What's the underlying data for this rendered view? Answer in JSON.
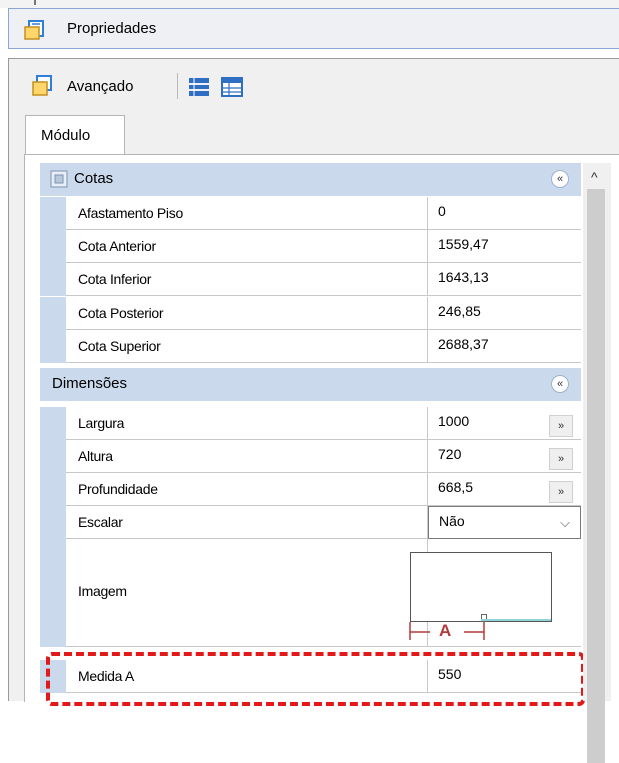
{
  "window": {
    "title": "Propriedades"
  },
  "toolbar": {
    "advanced_label": "Avançado"
  },
  "tabs": [
    {
      "label": "Módulo",
      "active": true
    }
  ],
  "categories": {
    "cotas": {
      "label": "Cotas",
      "rows": [
        {
          "name": "Afastamento Piso",
          "value": "0"
        },
        {
          "name": "Cota Anterior",
          "value": "1559,47"
        },
        {
          "name": "Cota Inferior",
          "value": "1643,13"
        },
        {
          "name": "Cota Posterior",
          "value": "246,85"
        },
        {
          "name": "Cota Superior",
          "value": "2688,37"
        }
      ]
    },
    "dimensoes": {
      "label": "Dimensões",
      "rows": [
        {
          "name": "Largura",
          "value": "1000"
        },
        {
          "name": "Altura",
          "value": "720"
        },
        {
          "name": "Profundidade",
          "value": "668,5"
        },
        {
          "name": "Escalar",
          "value": "Não"
        },
        {
          "name": "Imagem",
          "value": ""
        },
        {
          "name": "Medida A",
          "value": "550"
        }
      ]
    }
  },
  "preview": {
    "dimension_label": "A"
  },
  "glyphs": {
    "collapse": "«",
    "ellipsis": "»",
    "dropdown": "⌵",
    "scroll_up": "^"
  },
  "colors": {
    "category_bg": "#cad9ec",
    "highlight": "#e31818"
  }
}
